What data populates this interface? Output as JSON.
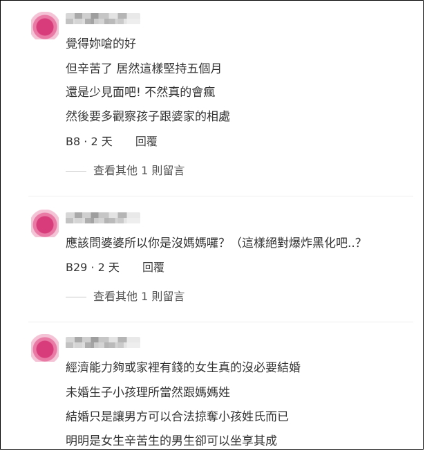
{
  "comments": [
    {
      "lines": [
        "覺得妳嗆的好",
        "但辛苦了 居然這樣堅持五個月",
        "還是少見面吧! 不然真的會瘋",
        "然後要多觀察孩子跟婆家的相處"
      ],
      "floor": "B8",
      "sep": "·",
      "time": "2 天",
      "reply": "回覆",
      "more": "查看其他 1 則留言"
    },
    {
      "lines": [
        "應該問婆婆所以你是沒媽媽囉？（這樣絕對爆炸黑化吧..？"
      ],
      "floor": "B29",
      "sep": "·",
      "time": "2 天",
      "reply": "回覆",
      "more": "查看其他 1 則留言"
    },
    {
      "lines": [
        "經濟能力夠或家裡有錢的女生真的沒必要結婚",
        "未婚生子小孩理所當然跟媽媽姓",
        "結婚只是讓男方可以合法掠奪小孩姓氏而已",
        "明明是女生辛苦生的男生卻可以坐享其成"
      ]
    }
  ],
  "colors": {
    "text": "#333333",
    "muted": "#555555",
    "avatar": "#d83c7a"
  }
}
